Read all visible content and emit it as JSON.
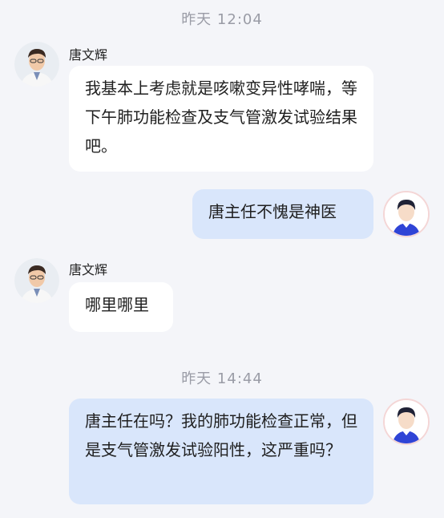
{
  "messages": [
    {
      "type": "timestamp",
      "text": "昨天  12:04"
    },
    {
      "type": "incoming",
      "sender": "唐文辉",
      "text": "我基本上考虑就是咳嗽变异性哮喘，等下午肺功能检查及支气管激发试验结果吧。"
    },
    {
      "type": "outgoing",
      "text": "唐主任不愧是神医"
    },
    {
      "type": "incoming",
      "sender": "唐文辉",
      "text": "哪里哪里"
    },
    {
      "type": "timestamp",
      "text": "昨天  14:44"
    },
    {
      "type": "outgoing",
      "text": "唐主任在吗？我的肺功能检查正常，但是支气管激发试验阳性，这严重吗？"
    }
  ],
  "colors": {
    "background": "#f4f5f9",
    "incoming_bubble": "#ffffff",
    "outgoing_bubble": "#d9e6fb",
    "timestamp": "#9a9ca6"
  },
  "icons": {
    "doctor_avatar": "doctor-photo-avatar",
    "user_avatar": "default-user-avatar"
  }
}
